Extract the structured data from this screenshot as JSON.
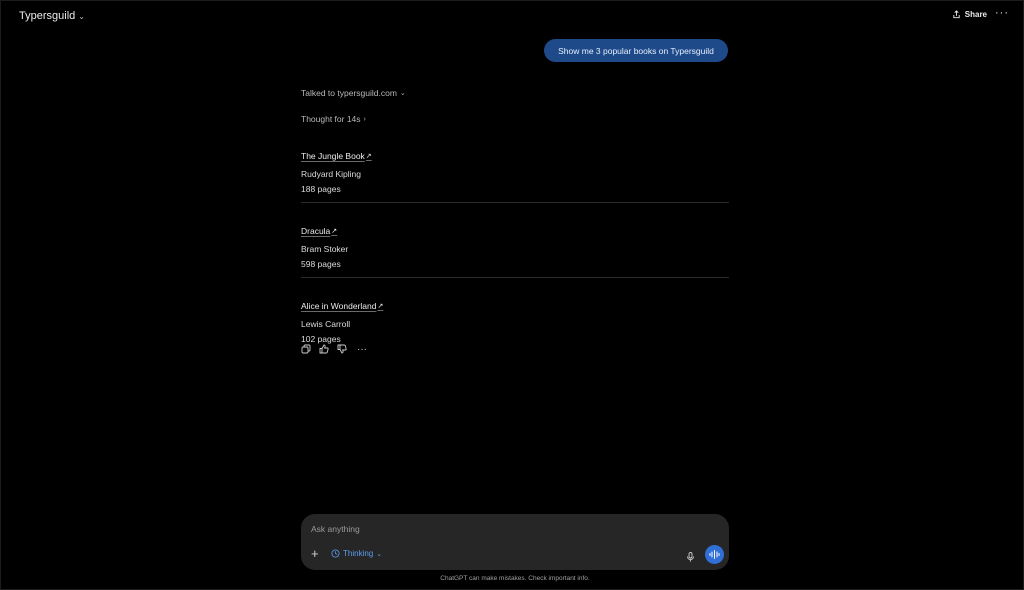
{
  "header": {
    "title": "Typersguild",
    "share_label": "Share",
    "more_label": "···"
  },
  "conversation": {
    "user_message": "Show me 3 popular books on Typersguild",
    "tool_status": "Talked to typersguild.com",
    "thought_status": "Thought for 14s",
    "books": [
      {
        "title": "The Jungle Book",
        "author": "Rudyard Kipling",
        "pages": "188 pages"
      },
      {
        "title": "Dracula",
        "author": "Bram Stoker",
        "pages": "598 pages"
      },
      {
        "title": "Alice in Wonderland",
        "author": "Lewis Carroll",
        "pages": "102 pages"
      }
    ],
    "more_actions": "···"
  },
  "composer": {
    "placeholder": "Ask anything",
    "mode_label": "Thinking"
  },
  "footer": {
    "disclaimer": "ChatGPT can make mistakes. Check important info."
  },
  "colors": {
    "background": "#000000",
    "user_bubble": "#1e4a8a",
    "accent": "#5b9cf0",
    "voice_button": "#2f6fd6",
    "composer": "#262626"
  }
}
